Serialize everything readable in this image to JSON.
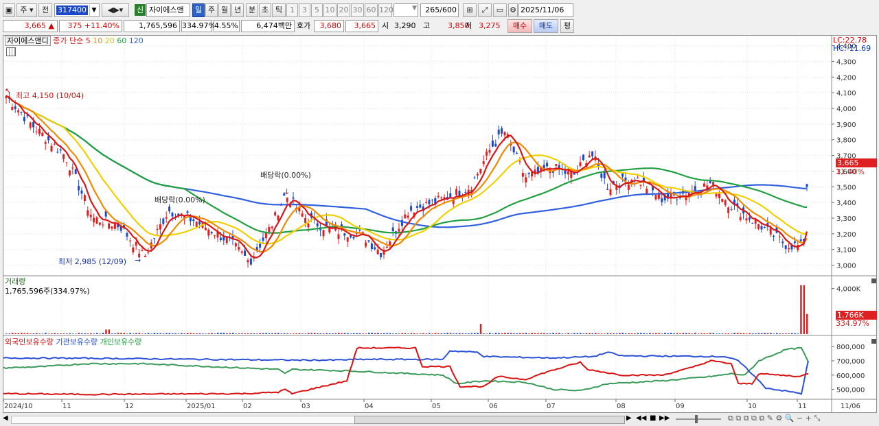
{
  "toolbar": {
    "period": "주",
    "prev": "전",
    "code": "317400",
    "name": "자이에스앤",
    "new_badge": "신",
    "periods": [
      "일",
      "주",
      "월",
      "년",
      "분",
      "초",
      "틱"
    ],
    "intervals": [
      "1",
      "3",
      "5",
      "10",
      "20",
      "30",
      "60",
      "120"
    ],
    "count": "265",
    "count_total": "/600",
    "date": "2025/11/06"
  },
  "quote": {
    "price": "3,665",
    "change": "375",
    "change_pct": "+11.40%",
    "volume": "1,765,596",
    "vol_ratio": "334.97%",
    "turnover": "4.55%",
    "amount": "6,474백만",
    "ask_label": "호가",
    "ask1": "3,680",
    "ask2": "3,665",
    "open_label": "시",
    "open": "3,290",
    "high_label": "고",
    "high": "3,850",
    "low_label": "저",
    "low": "3,275",
    "buy": "매수",
    "sell": "매도",
    "avg": "평"
  },
  "price_panel": {
    "legend_name": "자이에스앤디",
    "legend_ma": "종가 단순",
    "ma_periods": [
      "5",
      "10",
      "20",
      "60",
      "120"
    ],
    "ma_colors": [
      "#d81818",
      "#f08a00",
      "#f0d000",
      "#20a040",
      "#3060e0"
    ],
    "lc": "LC:22.78",
    "hc": "HC:-11.69",
    "price_tag": "3,665",
    "pct_tag": "11.40%",
    "high_note": "최고 4,150 (10/04)",
    "low_note": "최저 2,985 (12/09)",
    "dividend1": "배당락(0.00%)",
    "dividend2": "배당락(0.00%)",
    "yaxis": [
      "4,400",
      "4,300",
      "4,200",
      "4,100",
      "4,000",
      "3,900",
      "3,800",
      "3,700",
      "3,600",
      "3,500",
      "3,400",
      "3,300",
      "3,200",
      "3,100",
      "3,000"
    ]
  },
  "volume_panel": {
    "title": "거래량",
    "value": "1,765,596주(334.97%)",
    "yaxis": [
      "4,000K"
    ],
    "tag": "1,766K",
    "tag2": "334.97%"
  },
  "holding_panel": {
    "foreign": "외국인보유수량",
    "inst": "기관보유수량",
    "indiv": "개인보유수량",
    "yaxis": [
      "800,000",
      "700,000",
      "600,000",
      "500,000"
    ]
  },
  "xaxis": [
    "2024/10",
    "11",
    "12",
    "2025/01",
    "02",
    "03",
    "04",
    "05",
    "06",
    "07",
    "08",
    "09",
    "10",
    "11",
    "11/06"
  ],
  "chart_data": {
    "type": "line",
    "title": "자이에스앤디",
    "x": [
      "2024/10",
      "2024/11",
      "2024/12",
      "2025/01",
      "2025/02",
      "2025/03",
      "2025/04",
      "2025/05",
      "2025/06",
      "2025/07",
      "2025/08",
      "2025/09",
      "2025/10",
      "2025/11"
    ],
    "series": [
      {
        "name": "종가",
        "values": [
          4100,
          3500,
          3050,
          3200,
          3250,
          3350,
          3150,
          3300,
          3700,
          3600,
          3550,
          3450,
          3200,
          3665
        ]
      },
      {
        "name": "외국인보유수량",
        "values": [
          475000,
          470000,
          470000,
          470000,
          470000,
          560000,
          770000,
          560000,
          570000,
          630000,
          560000,
          660000,
          600000,
          610000
        ]
      },
      {
        "name": "기관보유수량",
        "values": [
          720000,
          720000,
          715000,
          712000,
          705000,
          700000,
          700000,
          720000,
          740000,
          725000,
          720000,
          710000,
          700000,
          690000
        ]
      },
      {
        "name": "개인보유수량",
        "values": [
          650000,
          680000,
          680000,
          665000,
          640000,
          630000,
          600000,
          590000,
          550000,
          560000,
          580000,
          590000,
          620000,
          690000
        ]
      }
    ],
    "ylim": [
      2950,
      4420
    ],
    "high": 4150,
    "low": 2985
  }
}
